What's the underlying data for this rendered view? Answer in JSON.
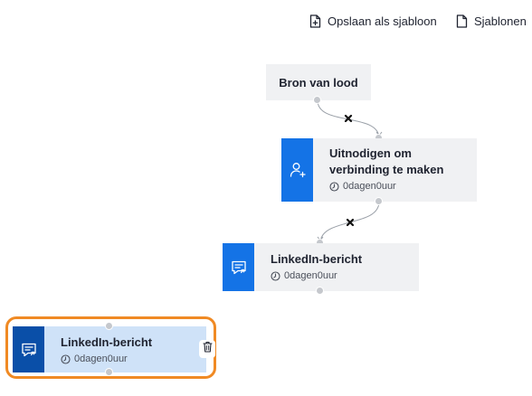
{
  "toolbar": {
    "save_template_label": "Opslaan als sjabloon",
    "templates_label": "Sjablonen"
  },
  "nodes": {
    "source": {
      "title": "Bron van lood"
    },
    "invite": {
      "title_line1": "Uitnodigen om",
      "title_line2": "verbinding te maken",
      "delay": "0dagen0uur",
      "icon": "user-plus-icon"
    },
    "linkedin_message_1": {
      "title": "LinkedIn-bericht",
      "delay": "0dagen0uur",
      "icon": "message-icon"
    },
    "linkedin_message_2": {
      "title": "LinkedIn-bericht",
      "delay": "0dagen0uur",
      "icon": "message-icon",
      "selected": true
    }
  },
  "colors": {
    "accent": "#1473e6",
    "accent_dark": "#0a4fa8",
    "selection": "#f08a24",
    "node_bg": "#f0f1f3",
    "selected_node_bg": "#cfe2f8"
  }
}
